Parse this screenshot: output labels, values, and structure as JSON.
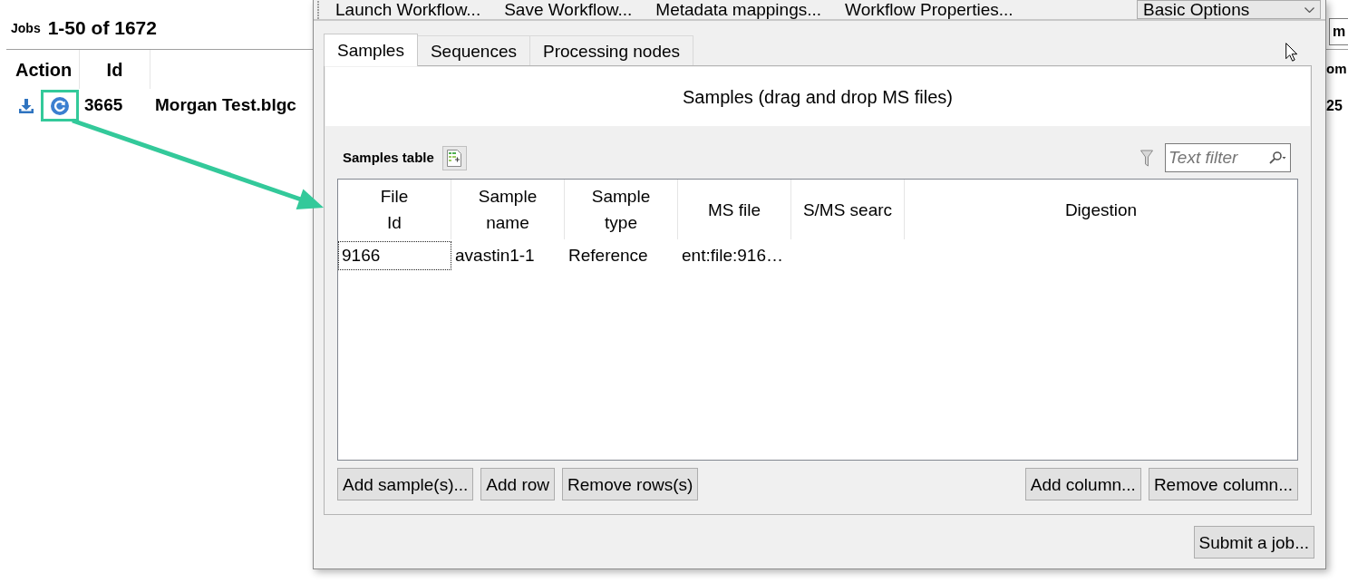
{
  "jobs_page": {
    "title": "Jobs",
    "range": "1-50 of 1672",
    "columns": [
      "Action",
      "Id"
    ],
    "rows": [
      {
        "id": "3665",
        "name": "Morgan Test.blgc"
      }
    ],
    "edge_button": "m",
    "edge_header": "om",
    "edge_cell": "25"
  },
  "dialog": {
    "toolbar": [
      "Launch Workflow...",
      "Save Workflow...",
      "Metadata mappings...",
      "Workflow Properties..."
    ],
    "mode_select": {
      "value": "Basic Options"
    },
    "tabs": [
      {
        "label": "Samples",
        "selected": true
      },
      {
        "label": "Sequences",
        "selected": false
      },
      {
        "label": "Processing nodes",
        "selected": false
      }
    ],
    "drop_hint": "Samples (drag and drop MS files)",
    "table_title": "Samples table",
    "filter": {
      "placeholder": "Text filter"
    },
    "table": {
      "columns": [
        "File\nId",
        "Sample\nname",
        "Sample\ntype",
        "MS file",
        "S/MS searc",
        "Digestion"
      ],
      "rows": [
        {
          "cells": [
            {
              "text": "9166",
              "focused": true
            },
            {
              "text": "avastin1-1",
              "focused": false
            },
            {
              "text": "Reference",
              "focused": false
            },
            {
              "text": "ent:file:916…",
              "focused": false
            }
          ]
        }
      ]
    },
    "table_buttons_left": [
      "Add sample(s)...",
      "Add row",
      "Remove rows(s)"
    ],
    "table_buttons_right": [
      "Add column...",
      "Remove column..."
    ],
    "submit": "Submit a job..."
  }
}
